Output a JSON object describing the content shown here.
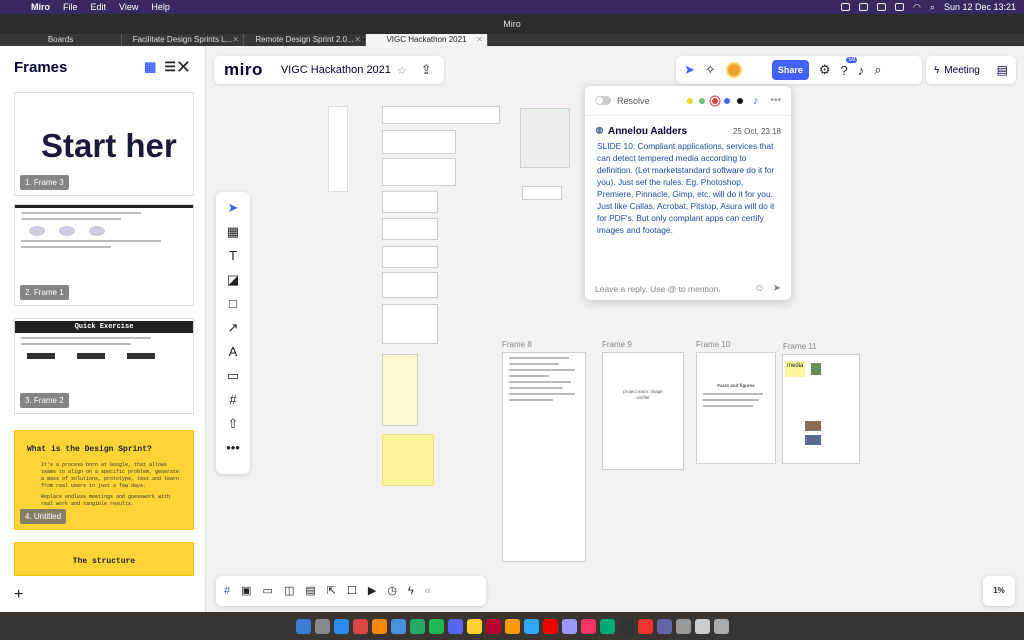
{
  "menubar": {
    "app_name": "Miro",
    "items": [
      "File",
      "Edit",
      "View",
      "Help"
    ],
    "datetime": "Sun 12 Dec  13:21"
  },
  "window": {
    "title": "Miro"
  },
  "tabs": [
    {
      "label": "Boards"
    },
    {
      "label": "Facilitate Design Sprints L..."
    },
    {
      "label": "Remote Design Sprint 2.0..."
    },
    {
      "label": "VIGC Hackathon 2021"
    }
  ],
  "sidebar": {
    "title": "Frames",
    "frames": [
      {
        "label": "1. Frame 3",
        "preview_text": "Start her"
      },
      {
        "label": "2. Frame 1"
      },
      {
        "label": "3. Frame 2",
        "heading": "Quick Exercise"
      },
      {
        "label": "4. Untitled",
        "heading": "What is the Design Sprint?",
        "bullets": [
          "It's a process born at Google, that allows teams to align on a specific problem, generate a mass of solutions, prototype, test and learn from real users in just a few days.",
          "Replace endless meetings and guesswork with real work and tangible results."
        ]
      },
      {
        "label": "",
        "heading": "The structure"
      }
    ]
  },
  "board": {
    "logo": "miro",
    "name": "VIGC Hackathon 2021",
    "share_label": "Share",
    "notifications_count": "59",
    "meeting_label": "Meeting",
    "zoom": "1%"
  },
  "canvas": {
    "frames": [
      {
        "label": "Frame 8"
      },
      {
        "label": "Frame 9",
        "text": "project team: image verifier"
      },
      {
        "label": "Frame 10",
        "text": "Facts and figures"
      },
      {
        "label": "Frame 11",
        "sticky": "media"
      }
    ]
  },
  "comment": {
    "resolve_label": "Resolve",
    "author": "Annelou Aalders",
    "date": "25 Oct, 23:18",
    "body": "SLIDE 10: Compliant applications, services that can detect tempered media according to definition. (Let marketstandard software do it for you). Just set the rules. Eg. Photoshop, Premiere, Pinnacle, Gimp, etc. will do it for you. Just like Callas, Acrobat, Pitstop, Asura will do it for PDF's. But only complant apps can certify images and footage.",
    "reply_placeholder": "Leave a reply. Use @ to mention.",
    "colors": [
      "#f5d328",
      "#6ac36a",
      "#e04040",
      "#4262ff",
      "#111111"
    ]
  },
  "colors": {
    "accent": "#4262ff",
    "brand_dark": "#050038",
    "sticky_yellow": "#fdd435"
  }
}
